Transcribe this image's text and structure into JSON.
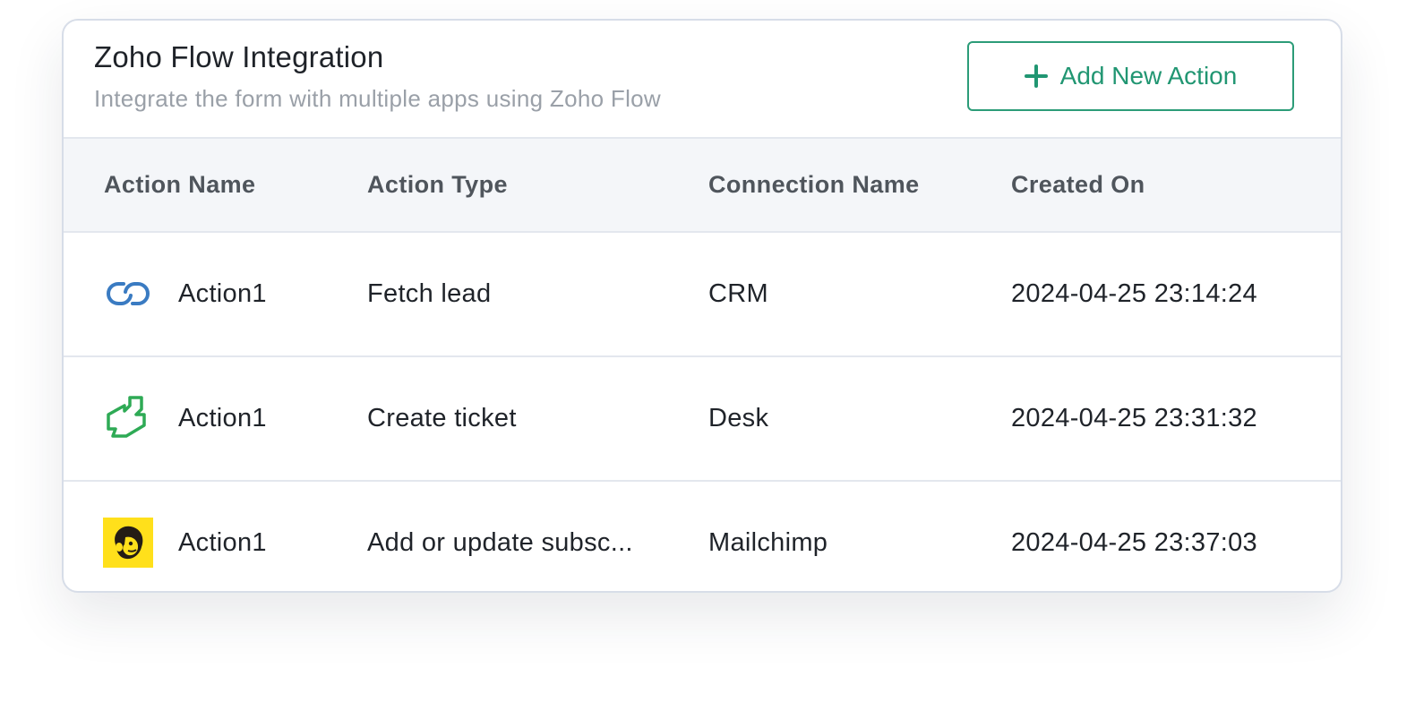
{
  "header": {
    "title": "Zoho Flow Integration",
    "subtitle": "Integrate the form with multiple apps using Zoho Flow",
    "add_button_label": "Add New Action"
  },
  "table": {
    "columns": [
      "Action Name",
      "Action Type",
      "Connection Name",
      "Created On"
    ],
    "rows": [
      {
        "icon": "zoho-crm-icon",
        "name": "Action1",
        "type": "Fetch lead",
        "connection": "CRM",
        "created": "2024-04-25 23:14:24"
      },
      {
        "icon": "zoho-desk-icon",
        "name": "Action1",
        "type": "Create ticket",
        "connection": "Desk",
        "created": "2024-04-25 23:31:32"
      },
      {
        "icon": "mailchimp-icon",
        "name": "Action1",
        "type": "Add or update subsc...",
        "connection": "Mailchimp",
        "created": "2024-04-25 23:37:03"
      }
    ]
  },
  "colors": {
    "accent": "#219672",
    "crm_icon": "#3a7bc2",
    "desk_icon": "#2eaa55",
    "mailchimp_bg": "#ffe01b"
  }
}
